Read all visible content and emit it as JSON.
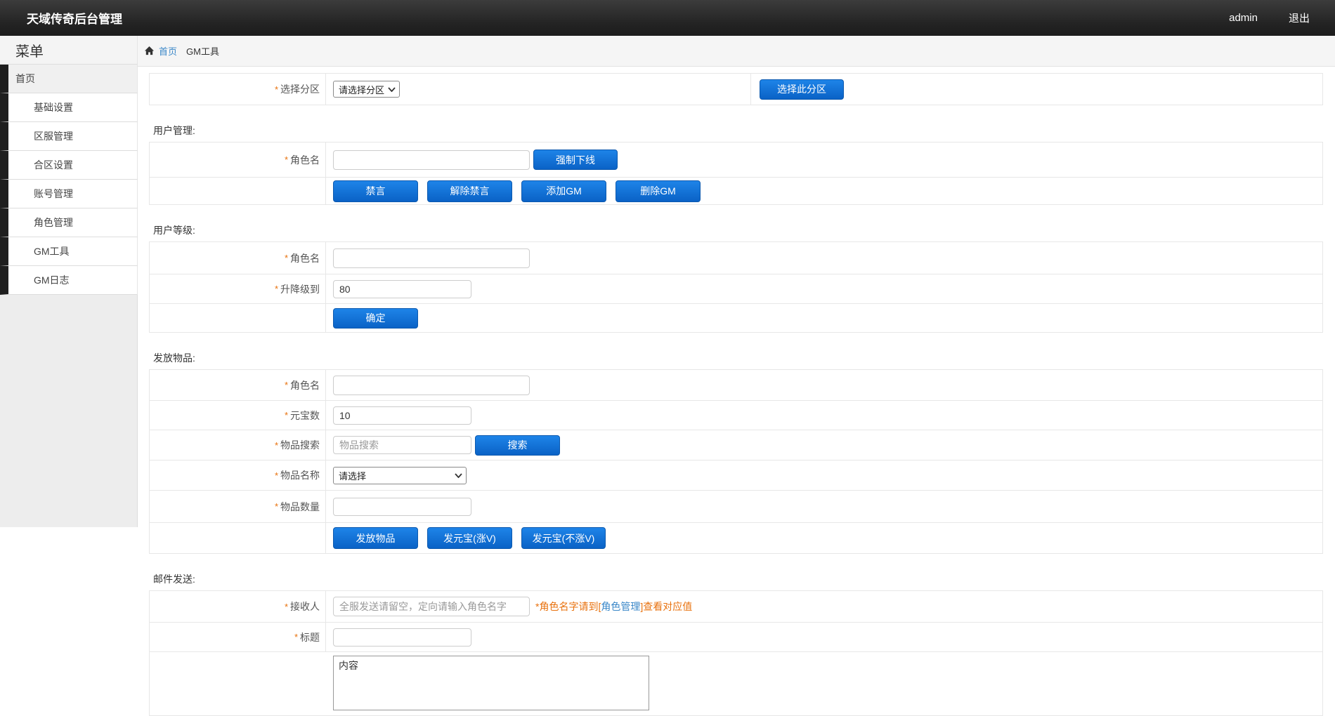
{
  "required_mark": "*",
  "topbar": {
    "title": "天域传奇后台管理",
    "username": "admin",
    "logout": "退出"
  },
  "sidebar": {
    "title": "菜单",
    "items": [
      "首页",
      "基础设置",
      "区服管理",
      "合区设置",
      "账号管理",
      "角色管理",
      "GM工具",
      "GM日志"
    ]
  },
  "breadcrumb": {
    "home": "首页",
    "current": "GM工具"
  },
  "colors": {
    "accent_blue": "#0f6bc8",
    "link_blue": "#3a87c8",
    "orange": "#e8710d",
    "topbar_bg": "#222222"
  },
  "zone_row": {
    "label": "选择分区",
    "select_value": "请选择分区",
    "button": "选择此分区"
  },
  "user_mgmt": {
    "heading": "用户管理:",
    "rolename_label": "角色名",
    "force_offline_button": "强制下线",
    "ban_button": "禁言",
    "unban_button": "解除禁言",
    "add_gm_button": "添加GM",
    "del_gm_button": "删除GM"
  },
  "user_level": {
    "heading": "用户等级:",
    "rolename_label": "角色名",
    "level_label": "升降级到",
    "level_value": "80",
    "confirm_button": "确定"
  },
  "items_grant": {
    "heading": "发放物品:",
    "rolename_label": "角色名",
    "yuanbao_label": "元宝数",
    "yuanbao_value": "10",
    "search_label": "物品搜索",
    "search_placeholder": "物品搜索",
    "search_button": "搜索",
    "item_name_label": "物品名称",
    "item_select_value": "请选择",
    "item_count_label": "物品数量",
    "grant_button": "发放物品",
    "send_yuanbao_v_button": "发元宝(涨V)",
    "send_yuanbao_nov_button": "发元宝(不涨V)"
  },
  "mail": {
    "heading": "邮件发送:",
    "receiver_label": "接收人",
    "receiver_placeholder": "全服发送请留空，定向请输入角色名字",
    "hint_prefix": "*角色名字请到",
    "hint_bracket_open": "[",
    "hint_link": "角色管理",
    "hint_bracket_close": "]",
    "hint_suffix": "查看对应值",
    "title_label": "标题",
    "content_value": "内容"
  }
}
